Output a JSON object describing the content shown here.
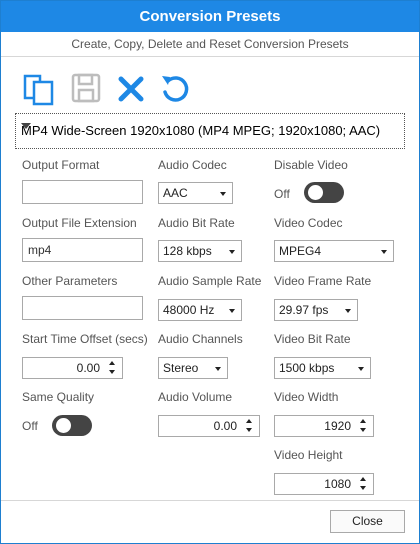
{
  "window": {
    "title": "Conversion Presets",
    "subtitle": "Create, Copy, Delete and Reset Conversion Presets"
  },
  "toolbar": {
    "buttons": [
      {
        "icon": "copy-icon",
        "enabled": true
      },
      {
        "icon": "save-icon",
        "enabled": false
      },
      {
        "icon": "delete-icon",
        "enabled": true
      },
      {
        "icon": "reset-icon",
        "enabled": true
      }
    ]
  },
  "preset": {
    "selected": "MP4 Wide-Screen 1920x1080 (MP4 MPEG; 1920x1080; AAC)"
  },
  "fields": {
    "output_format": {
      "label": "Output Format",
      "value": ""
    },
    "output_file_extension": {
      "label": "Output File Extension",
      "value": "mp4"
    },
    "other_parameters": {
      "label": "Other Parameters",
      "value": ""
    },
    "start_time_offset": {
      "label": "Start Time Offset (secs)",
      "value": "0.00"
    },
    "same_quality": {
      "label": "Same Quality",
      "state": "Off"
    },
    "audio_codec": {
      "label": "Audio Codec",
      "value": "AAC"
    },
    "audio_bit_rate": {
      "label": "Audio Bit Rate",
      "value": "128 kbps"
    },
    "audio_sample_rate": {
      "label": "Audio Sample Rate",
      "value": "48000 Hz"
    },
    "audio_channels": {
      "label": "Audio Channels",
      "value": "Stereo"
    },
    "audio_volume": {
      "label": "Audio Volume",
      "value": "0.00"
    },
    "disable_video": {
      "label": "Disable Video",
      "state": "Off"
    },
    "video_codec": {
      "label": "Video Codec",
      "value": "MPEG4"
    },
    "video_frame_rate": {
      "label": "Video Frame Rate",
      "value": "29.97 fps"
    },
    "video_bit_rate": {
      "label": "Video Bit Rate",
      "value": "1500 kbps"
    },
    "video_width": {
      "label": "Video Width",
      "value": "1920"
    },
    "video_height": {
      "label": "Video Height",
      "value": "1080"
    }
  },
  "footer": {
    "close_label": "Close"
  },
  "colors": {
    "titlebar": "#1e88e5",
    "icon_blue": "#1e88e5",
    "toggle_off": "#444444",
    "disabled_icon": "#bdbdbd"
  }
}
